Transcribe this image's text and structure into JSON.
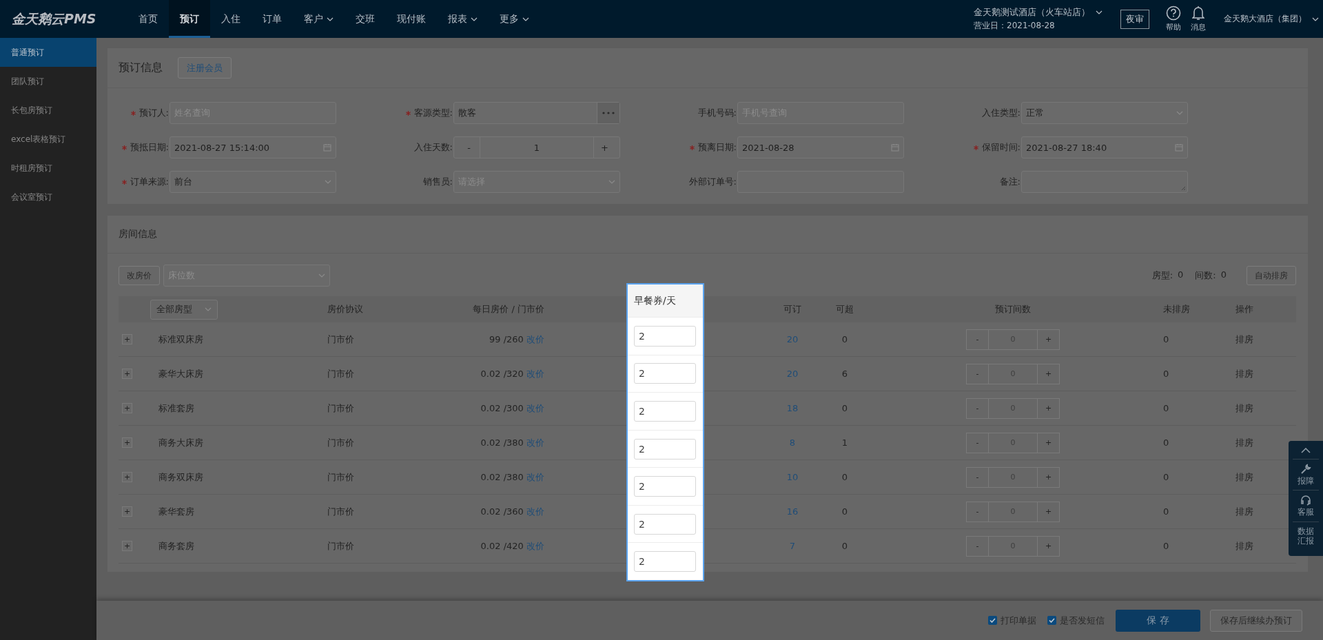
{
  "app": {
    "logo": "金天鹅云PMS"
  },
  "nav": [
    {
      "label": "首页",
      "selected": false,
      "dropdown": false
    },
    {
      "label": "预订",
      "selected": true,
      "dropdown": false
    },
    {
      "label": "入住",
      "selected": false,
      "dropdown": false
    },
    {
      "label": "订单",
      "selected": false,
      "dropdown": false
    },
    {
      "label": "客户",
      "selected": false,
      "dropdown": true
    },
    {
      "label": "交班",
      "selected": false,
      "dropdown": false
    },
    {
      "label": "现付账",
      "selected": false,
      "dropdown": false
    },
    {
      "label": "报表",
      "selected": false,
      "dropdown": true
    },
    {
      "label": "更多",
      "selected": false,
      "dropdown": true
    }
  ],
  "hotel": {
    "name": "金天鹅测试酒店（火车站店）",
    "business_date": "营业日：2021-08-28"
  },
  "night_audit_button": "夜审",
  "help": "帮助",
  "messages": "消息",
  "group": "金天鹅大酒店（集团）",
  "sidebar": [
    {
      "label": "普通预订",
      "selected": true
    },
    {
      "label": "团队预订",
      "selected": false
    },
    {
      "label": "长包房预订",
      "selected": false
    },
    {
      "label": "excel表格预订",
      "selected": false
    },
    {
      "label": "时租房预订",
      "selected": false
    },
    {
      "label": "会议室预订",
      "selected": false
    }
  ],
  "booking_info": {
    "title": "预订信息",
    "register_button": "注册会员",
    "fields": [
      {
        "label": "预订人:",
        "required": true,
        "kind": "text",
        "placeholder": "姓名查询"
      },
      {
        "label": "客源类型:",
        "required": true,
        "kind": "more",
        "value": "散客"
      },
      {
        "label": "手机号码:",
        "required": false,
        "kind": "text",
        "placeholder": "手机号查询"
      },
      {
        "label": "入住类型:",
        "required": false,
        "kind": "select",
        "value": "正常"
      },
      {
        "label": "预抵日期:",
        "required": true,
        "kind": "date",
        "value": "2021-08-27 15:14:00"
      },
      {
        "label": "入住天数:",
        "required": false,
        "kind": "stepper",
        "value": "1",
        "minus": "-",
        "plus": "+"
      },
      {
        "label": "预离日期:",
        "required": true,
        "kind": "date",
        "value": "2021-08-28"
      },
      {
        "label": "保留时间:",
        "required": true,
        "kind": "date",
        "value": "2021-08-27 18:40"
      },
      {
        "label": "订单来源:",
        "required": true,
        "kind": "select",
        "value": "前台"
      },
      {
        "label": "销售员:",
        "required": false,
        "kind": "select",
        "placeholder": "请选择"
      },
      {
        "label": "外部订单号:",
        "required": false,
        "kind": "text"
      },
      {
        "label": "备注:",
        "required": false,
        "kind": "textarea"
      }
    ]
  },
  "room_info": {
    "title": "房间信息",
    "change_price_button": "改房价",
    "bed_select": {
      "placeholder": "床位数"
    },
    "summary": [
      {
        "label": "房型:",
        "value": "0"
      },
      {
        "label": "间数:",
        "value": "0"
      }
    ],
    "auto_assign_button": "自动排房",
    "room_type_filter": "全部房型",
    "columns": [
      "房价协议",
      "每日房价 / 门市价",
      "可订",
      "可超",
      "预订间数",
      "未排房",
      "操作"
    ],
    "rows": [
      {
        "room_type": "标准双床房",
        "agreement": "门市价",
        "price": "99 /260",
        "change_link": "改价",
        "available": "20",
        "overbook": "0",
        "rooms": "0",
        "unassigned": "0",
        "action": "排房"
      },
      {
        "room_type": "豪华大床房",
        "agreement": "门市价",
        "price": "0.02 /320",
        "change_link": "改价",
        "available": "20",
        "overbook": "6",
        "rooms": "0",
        "unassigned": "0",
        "action": "排房"
      },
      {
        "room_type": "标准套房",
        "agreement": "门市价",
        "price": "0.02 /300",
        "change_link": "改价",
        "available": "18",
        "overbook": "0",
        "rooms": "0",
        "unassigned": "0",
        "action": "排房"
      },
      {
        "room_type": "商务大床房",
        "agreement": "门市价",
        "price": "0.02 /380",
        "change_link": "改价",
        "available": "8",
        "overbook": "1",
        "rooms": "0",
        "unassigned": "0",
        "action": "排房"
      },
      {
        "room_type": "商务双床房",
        "agreement": "门市价",
        "price": "0.02 /380",
        "change_link": "改价",
        "available": "10",
        "overbook": "0",
        "rooms": "0",
        "unassigned": "0",
        "action": "排房"
      },
      {
        "room_type": "豪华套房",
        "agreement": "门市价",
        "price": "0.02 /360",
        "change_link": "改价",
        "available": "16",
        "overbook": "0",
        "rooms": "0",
        "unassigned": "0",
        "action": "排房"
      },
      {
        "room_type": "商务套房",
        "agreement": "门市价",
        "price": "0.02 /420",
        "change_link": "改价",
        "available": "7",
        "overbook": "0",
        "rooms": "0",
        "unassigned": "0",
        "action": "排房"
      }
    ],
    "expand": "+",
    "minus": "-",
    "plus": "+"
  },
  "breakfast_column": {
    "header": "早餐券/天",
    "values": [
      "2",
      "2",
      "2",
      "2",
      "2",
      "2",
      "2"
    ]
  },
  "side_tools": [
    "报障",
    "客服",
    "数据汇报"
  ],
  "footer": {
    "checkboxes": [
      {
        "label": "打印单据",
        "checked": true
      },
      {
        "label": "是否发短信",
        "checked": true
      }
    ],
    "save_button": "保 存",
    "save_continue_button": "保存后继续办预订"
  }
}
